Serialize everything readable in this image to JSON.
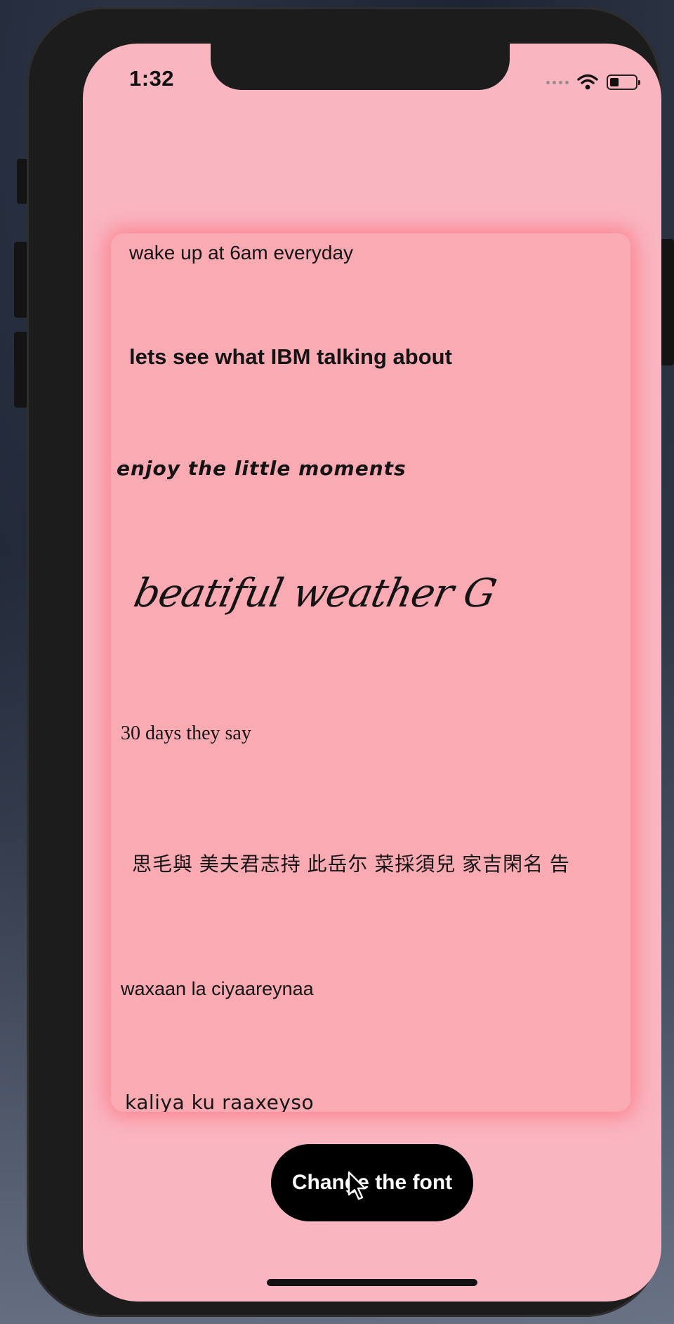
{
  "status_bar": {
    "time": "1:32",
    "signal_icon": "signal-dots-icon",
    "wifi_icon": "wifi-icon",
    "battery_icon": "battery-icon"
  },
  "card": {
    "lines": [
      "wake up at 6am everyday",
      "lets see what IBM talking about",
      "enjoy the little moments",
      "beatiful weather G",
      "30 days they say",
      "思毛與  美夫君志持  此岳尓  菜採須兒  家吉閑名  告",
      "waxaan la ciyaareynaa",
      "kaliya ku raaxeyso"
    ]
  },
  "button": {
    "label": "Change the font"
  },
  "colors": {
    "screen_bg": "#f9b6c1",
    "card_bg": "#f9aab3",
    "card_glow": "#ff5c6e",
    "button_bg": "#000000",
    "button_text": "#ffffff"
  }
}
